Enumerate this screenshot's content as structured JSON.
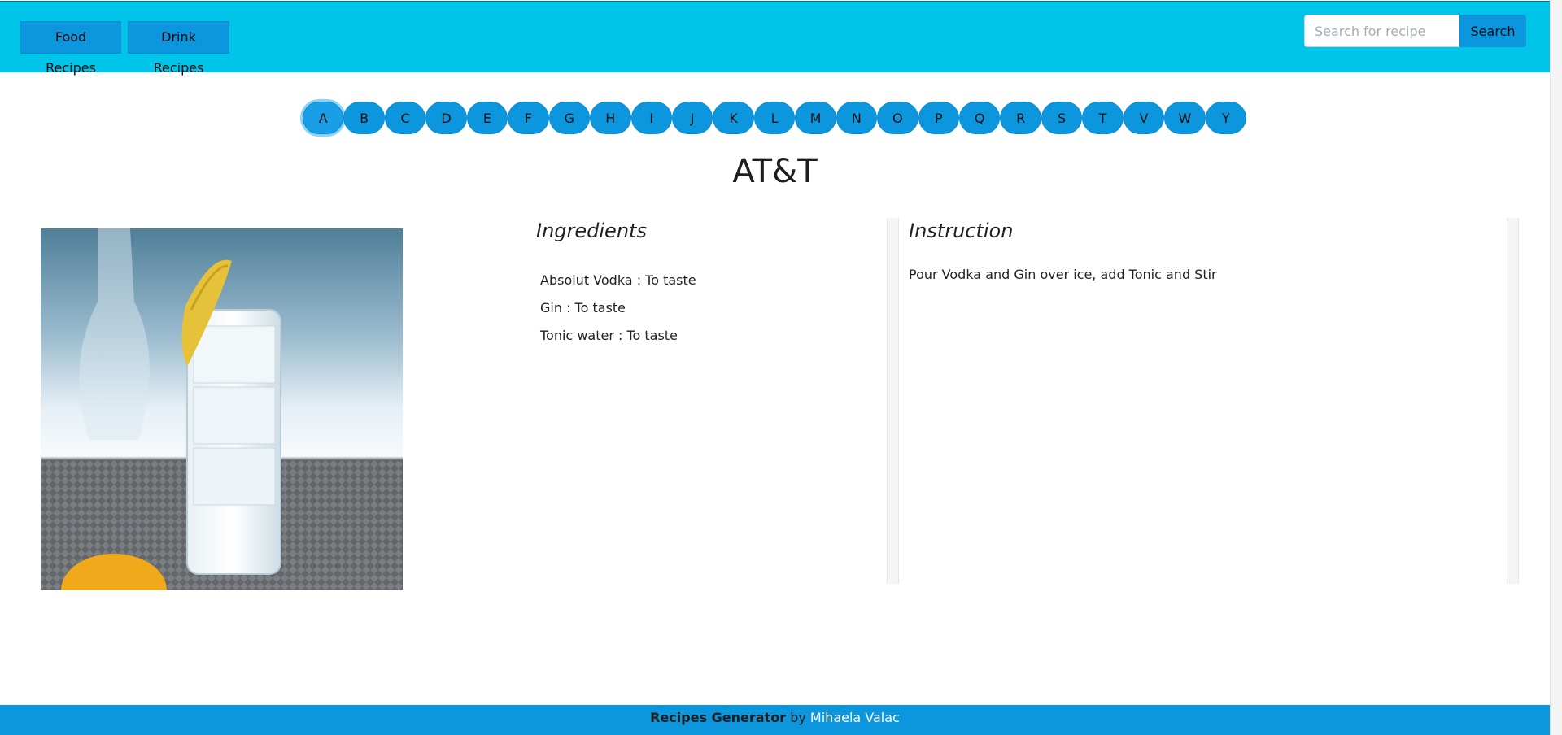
{
  "navbar": {
    "food_label": "Food Recipes",
    "drink_label": "Drink Recipes",
    "search_placeholder": "Search for recipe",
    "search_value": "",
    "search_button": "Search"
  },
  "letters": [
    "A",
    "B",
    "C",
    "D",
    "E",
    "F",
    "G",
    "H",
    "I",
    "J",
    "K",
    "L",
    "M",
    "N",
    "O",
    "P",
    "Q",
    "R",
    "S",
    "T",
    "V",
    "W",
    "Y"
  ],
  "active_letter": "A",
  "recipe": {
    "title": "AT&T",
    "ingredients_heading": "Ingredients",
    "ingredients": [
      "Absolut Vodka : To taste",
      "Gin : To taste",
      "Tonic water : To taste"
    ],
    "instruction_heading": "Instruction",
    "instruction": "Pour Vodka and Gin over ice, add Tonic and Stir"
  },
  "footer": {
    "brand": "Recipes Generator",
    "by": "by",
    "author": "Mihaela Valac"
  },
  "colors": {
    "navbar": "#00c4e8",
    "accent": "#0b96de",
    "footer": "#0b96de"
  }
}
